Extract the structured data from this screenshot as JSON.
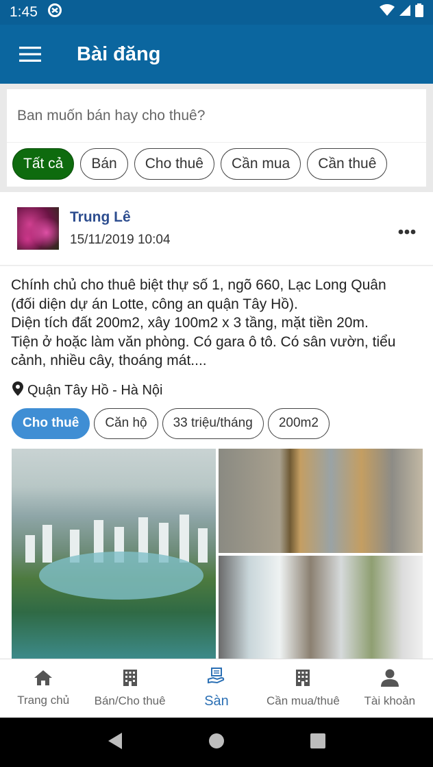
{
  "status": {
    "time": "1:45"
  },
  "appbar": {
    "title": "Bài đăng"
  },
  "composer": {
    "prompt": "Ban muốn bán hay cho thuê?",
    "filters": [
      {
        "label": "Tất cả",
        "active": true
      },
      {
        "label": "Bán"
      },
      {
        "label": "Cho thuê"
      },
      {
        "label": "Cần mua"
      },
      {
        "label": "Cần thuê"
      }
    ]
  },
  "post": {
    "author": "Trung Lê",
    "timestamp": "15/11/2019 10:04",
    "text_lines": [
      "Chính chủ cho thuê biệt thự số 1, ngõ 660, Lạc Long Quân",
      "(đối diện dự án Lotte, công an quận Tây Hồ).",
      "Diện tích đất 200m2, xây 100m2 x 3 tầng, mặt tiền 20m.",
      "Tiện ở hoặc làm văn phòng. Có gara ô tô. Có sân vườn, tiểu",
      "cảnh, nhiều cây, thoáng mát...."
    ],
    "location": "Quận Tây Hồ - Hà Nội",
    "tags": [
      "Cho thuê",
      "Căn hộ",
      "33 triệu/tháng",
      "200m2"
    ]
  },
  "bottom_nav": [
    {
      "label": "Trang chủ",
      "icon": "home-icon"
    },
    {
      "label": "Bán/Cho thuê",
      "icon": "building-icon"
    },
    {
      "label": "Sàn",
      "icon": "hand-house-icon",
      "active": true
    },
    {
      "label": "Cần mua/thuê",
      "icon": "building-icon"
    },
    {
      "label": "Tài khoản",
      "icon": "user-icon"
    }
  ],
  "colors": {
    "appbar": "#0b669f",
    "active_chip": "#0e6b0e",
    "active_tag": "#3f8ed4",
    "nav_active": "#2a6fb4",
    "author": "#2d4d8f"
  }
}
